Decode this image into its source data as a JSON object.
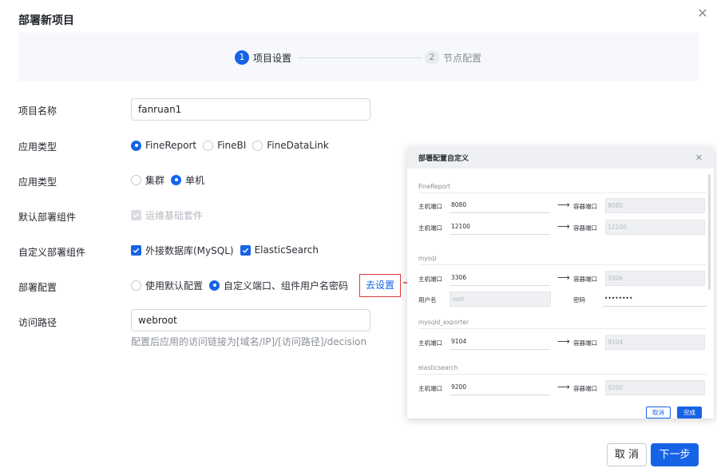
{
  "dialog": {
    "title": "部署新项目",
    "close_glyph": "✕"
  },
  "steps": [
    {
      "num": "1",
      "label": "项目设置",
      "state": "active"
    },
    {
      "num": "2",
      "label": "节点配置",
      "state": "idle"
    }
  ],
  "form": {
    "project_name": {
      "label": "项目名称",
      "value": "fanruan1"
    },
    "app_type": {
      "label": "应用类型",
      "options": [
        "FineReport",
        "FineBI",
        "FineDataLink"
      ],
      "selected": "FineReport"
    },
    "deploy_mode": {
      "label": "应用类型",
      "options": [
        "集群",
        "单机"
      ],
      "selected": "单机"
    },
    "default_components": {
      "label": "默认部署组件",
      "options": [
        "运维基础套件"
      ]
    },
    "custom_components": {
      "label": "自定义部署组件",
      "options": [
        "外接数据库(MySQL)",
        "ElasticSearch"
      ]
    },
    "deploy_config": {
      "label": "部署配置",
      "options": [
        "使用默认配置",
        "自定义端口、组件用户名密码"
      ],
      "selected": "自定义端口、组件用户名密码",
      "link": "去设置"
    },
    "access_path": {
      "label": "访问路径",
      "value": "webroot",
      "hint": "配置后应用的访问链接为[域名/IP]/[访问路径]/decision"
    }
  },
  "sub_dialog": {
    "title": "部署配置自定义",
    "close_glyph": "✕",
    "host_label": "主机端口",
    "container_label": "容器端口",
    "user_label": "用户名",
    "pwd_label": "密码",
    "sections": {
      "finereport": {
        "title": "FineReport",
        "rows": [
          {
            "host": "8080",
            "ctr": "8080"
          },
          {
            "host": "12100",
            "ctr": "12100"
          }
        ]
      },
      "mysql": {
        "title": "mysql",
        "host": "3306",
        "ctr": "3306",
        "user": "root",
        "pwd": "••••••••"
      },
      "mysqld_exporter": {
        "title": "mysqld_exporter",
        "host": "9104",
        "ctr": "9104"
      },
      "elasticsearch": {
        "title": "elasticsearch",
        "host": "9200",
        "ctr": "9200"
      }
    },
    "cancel": "取消",
    "done": "完成"
  },
  "footer": {
    "cancel": "取 消",
    "next": "下一步"
  },
  "colors": {
    "accent": "#1763e6",
    "highlight": "#e03a3a"
  }
}
